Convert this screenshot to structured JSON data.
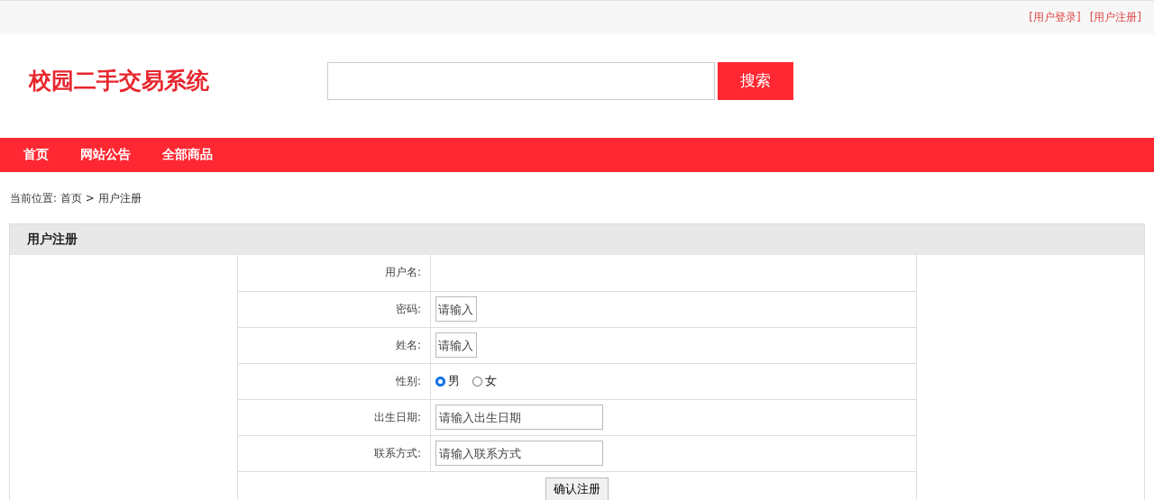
{
  "top_links": [
    "[用户登录]",
    "[用户注册]"
  ],
  "site_title": "校园二手交易系统",
  "search": {
    "button": "搜索"
  },
  "nav": [
    "首页",
    "网站公告",
    "全部商品"
  ],
  "breadcrumb": "当前位置: 首页 >  用户注册",
  "panel": {
    "title": "用户注册",
    "rows": [
      {
        "kind": "blank",
        "label": "用户名:"
      },
      {
        "kind": "short",
        "label": "密码:",
        "placeholder": "请输入"
      },
      {
        "kind": "short",
        "label": "姓名:",
        "placeholder": "请输入"
      },
      {
        "kind": "radio",
        "label": "性别:",
        "options": [
          {
            "label": "男",
            "selected": true
          },
          {
            "label": "女",
            "selected": false
          }
        ]
      },
      {
        "kind": "text",
        "label": "出生日期:",
        "placeholder": "请输入出生日期"
      },
      {
        "kind": "text",
        "label": "联系方式:",
        "placeholder": "请输入联系方式"
      }
    ],
    "submit": "确认注册"
  }
}
